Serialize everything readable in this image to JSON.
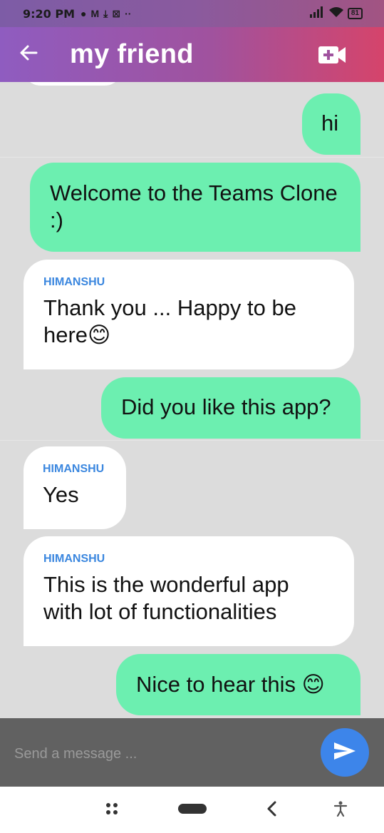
{
  "status_bar": {
    "time": "9:20 PM",
    "battery": "81",
    "icons": [
      "notification-dot-icon",
      "m-app-icon",
      "download-icon",
      "app-icon",
      "more-dots-icon",
      "signal-icon",
      "wifi-icon",
      "battery-icon"
    ]
  },
  "app_bar": {
    "back_icon": "arrow-left-icon",
    "title": "my friend",
    "video_call_icon": "video-plus-icon"
  },
  "messages": [
    {
      "direction": "sent",
      "text": "hi"
    },
    {
      "direction": "sent",
      "text": "Welcome to the Teams Clone :)"
    },
    {
      "direction": "received",
      "sender": "HIMANSHU",
      "text": "Thank you  ... Happy to be here😊"
    },
    {
      "direction": "sent",
      "text": "Did you like this app?"
    },
    {
      "direction": "received",
      "sender": "HIMANSHU",
      "text": "Yes"
    },
    {
      "direction": "received",
      "sender": "HIMANSHU",
      "text": "This is the wonderful app with lot of functionalities"
    },
    {
      "direction": "sent",
      "text": "Nice to hear this 😊"
    }
  ],
  "composer": {
    "placeholder": "Send a message ...",
    "value": "",
    "send_icon": "send-icon"
  },
  "nav_bar": {
    "items": [
      "menu-dots-icon",
      "home-pill-icon",
      "back-chevron-icon",
      "accessibility-icon"
    ]
  },
  "colors": {
    "sent_bubble": "#6cefb0",
    "received_bubble": "#ffffff",
    "sender_name": "#3b87df",
    "send_button": "#3d85ea",
    "chat_background": "#dcdcdc"
  }
}
